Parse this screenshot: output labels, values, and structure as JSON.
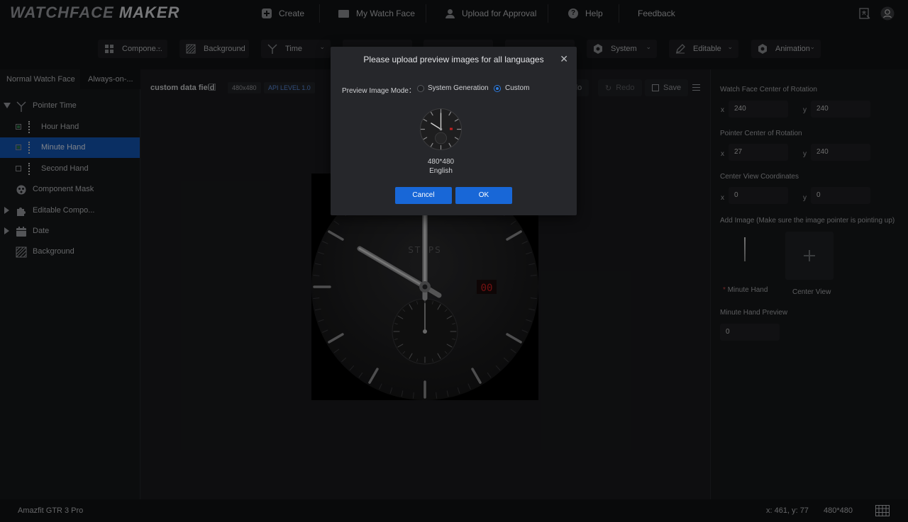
{
  "app": {
    "logo_light": "WATCHFACE",
    "logo_bold": "MAKER"
  },
  "topnav": {
    "create": "Create",
    "my_watch_face": "My Watch Face",
    "upload": "Upload for Approval",
    "help": "Help",
    "feedback": "Feedback"
  },
  "toolbar": {
    "items": [
      {
        "label": "Compone...",
        "icon": "grid-icon"
      },
      {
        "label": "Background",
        "icon": "stripes-icon"
      },
      {
        "label": "Time",
        "icon": "pointer-icon"
      },
      {
        "label": "",
        "icon": "hidden-icon"
      },
      {
        "label": "",
        "icon": "hidden-icon"
      },
      {
        "label": "",
        "icon": "hidden-icon"
      },
      {
        "label": "System",
        "icon": "gear-icon"
      },
      {
        "label": "Editable",
        "icon": "edit-icon"
      },
      {
        "label": "Animation",
        "icon": "gear-icon"
      }
    ]
  },
  "left": {
    "tab_normal": "Normal Watch Face",
    "tab_aod": "Always-on-...",
    "tree": [
      {
        "label": "Pointer Time"
      },
      {
        "label": "Hour Hand"
      },
      {
        "label": "Minute Hand"
      },
      {
        "label": "Second Hand"
      },
      {
        "label": "Component Mask"
      },
      {
        "label": "Editable Compo..."
      },
      {
        "label": "Date"
      },
      {
        "label": "Background"
      }
    ]
  },
  "center": {
    "title": "custom data field",
    "resolution": "480x480",
    "api": "API LEVEL 1.0",
    "undo": "do",
    "redo": "Redo",
    "save": "Save",
    "watch_steps": "STEPS",
    "watch_digits": "00"
  },
  "right": {
    "wf_center_label": "Watch Face Center of Rotation",
    "wf_center_x": "240",
    "wf_center_y": "240",
    "pointer_center_label": "Pointer Center of Rotation",
    "pointer_center_x": "27",
    "pointer_center_y": "240",
    "center_view_label": "Center View Coordinates",
    "center_view_x": "0",
    "center_view_y": "0",
    "x_axis": "x",
    "y_axis": "y",
    "add_image_label": "Add Image  (Make sure the image pointer is pointing up)",
    "minute_hand_caption": "Minute Hand",
    "required_mark": "*",
    "center_view_caption": "Center View",
    "preview_label": "Minute Hand Preview",
    "preview_value": "0"
  },
  "status": {
    "device": "Amazfit GTR 3 Pro",
    "coords": "x: 461, y: 77",
    "resolution": "480*480"
  },
  "modal": {
    "title": "Please upload preview images for all languages",
    "mode_label": "Preview Image Mode：",
    "opt_system": "System Generation",
    "opt_custom": "Custom",
    "selected": "Custom",
    "image_size": "480*480",
    "language": "English",
    "cancel": "Cancel",
    "ok": "OK"
  },
  "colors": {
    "accent": "#1867d7",
    "selection": "#1357b5",
    "digit_red": "#d22020"
  }
}
